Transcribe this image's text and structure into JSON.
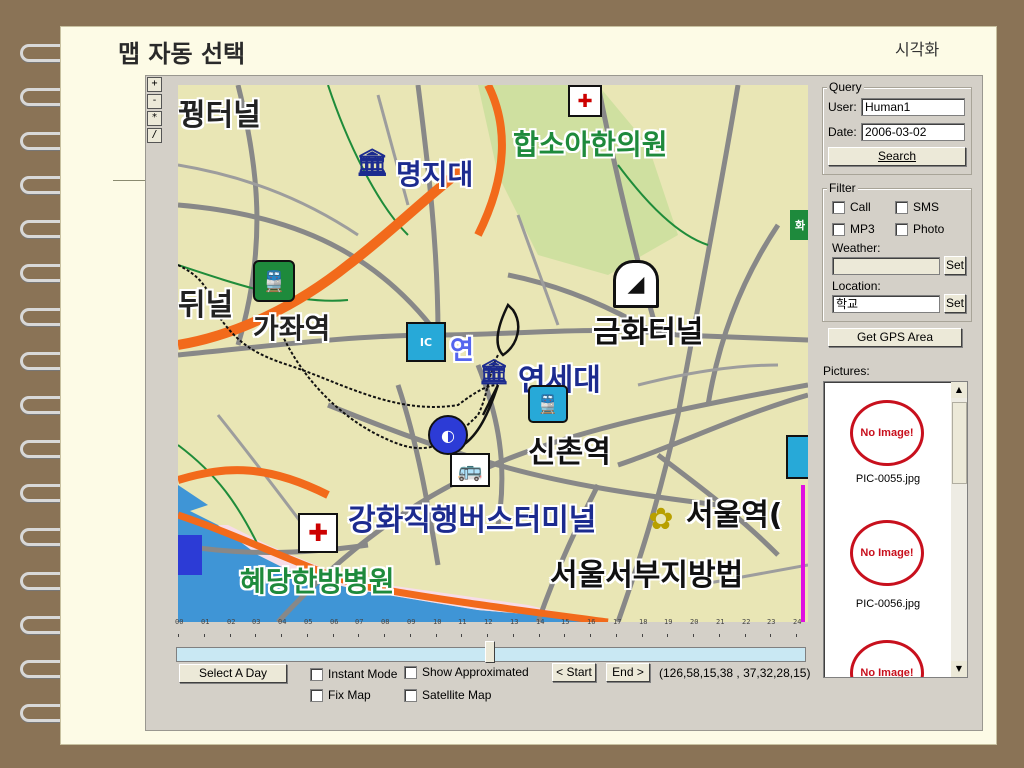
{
  "slide": {
    "title": "맵 자동 선택",
    "subtitle": "시각화"
  },
  "zoom_buttons": [
    "+",
    "-",
    "*",
    "/"
  ],
  "map": {
    "labels": {
      "l1": "꿩터널",
      "l2": "합소아한의원",
      "l3": "명지대",
      "l4": "뒤널",
      "l5": "가좌역",
      "l6": "금화터널",
      "l7": "연세대",
      "l8": "신촌역",
      "l9": "강화직행버스터미널",
      "l10": "서울역(",
      "l11": "혜당한방병원",
      "l12": "서울서부지방법",
      "l13": "IC",
      "l14": "연",
      "l15": "화"
    }
  },
  "query": {
    "title": "Query",
    "user_label": "User:",
    "user_value": "Human1",
    "date_label": "Date:",
    "date_value": "2006-03-02",
    "search_label": "Search"
  },
  "filter": {
    "title": "Filter",
    "call": "Call",
    "sms": "SMS",
    "mp3": "MP3",
    "photo": "Photo",
    "weather_label": "Weather:",
    "weather_value": "",
    "set_label": "Set",
    "location_label": "Location:",
    "location_value": "학교"
  },
  "gps_button": "Get GPS Area",
  "pictures": {
    "label": "Pictures:",
    "placeholder": "No Image!",
    "items": [
      "PIC-0055.jpg",
      "PIC-0056.jpg",
      ""
    ]
  },
  "timeline": {
    "hours": [
      "00",
      "01",
      "02",
      "03",
      "04",
      "05",
      "06",
      "07",
      "08",
      "09",
      "10",
      "11",
      "12",
      "13",
      "14",
      "15",
      "16",
      "17",
      "18",
      "19",
      "20",
      "21",
      "22",
      "23",
      "24"
    ],
    "position": 0.5
  },
  "controls": {
    "select_day": "Select A Day",
    "instant_mode": "Instant Mode",
    "show_approx": "Show Approximated",
    "fix_map": "Fix Map",
    "satellite_map": "Satellite Map",
    "start": "< Start",
    "end": "End >",
    "coords": "(126,58,15,38 ,  37,32,28,15)"
  },
  "colors": {
    "background": "#8a7356",
    "page": "#fdfbe6",
    "window": "#d4d0c8",
    "map_bg": "#e9e6b5",
    "road_orange": "#f26a1b",
    "water": "#3f95d6"
  }
}
